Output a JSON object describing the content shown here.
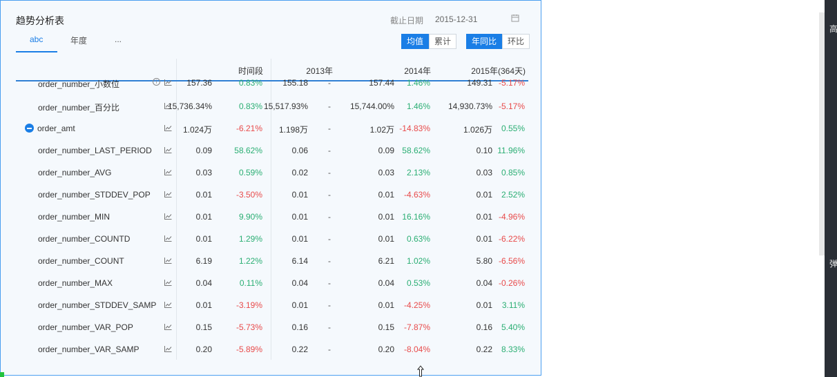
{
  "widget": {
    "title": "趋势分析表",
    "date_label": "截止日期",
    "date_value": "2015-12-31",
    "calendar_icon": "calendar-icon"
  },
  "tabs": [
    {
      "label": "abc",
      "active": true
    },
    {
      "label": "年度",
      "active": false
    },
    {
      "label": "...",
      "active": false
    }
  ],
  "toggle_groups": {
    "aggregate": [
      {
        "label": "均值",
        "active": true
      },
      {
        "label": "累计",
        "active": false
      }
    ],
    "compare": [
      {
        "label": "年同比",
        "active": true
      },
      {
        "label": "环比",
        "active": false
      }
    ]
  },
  "columns": [
    "时间段",
    "2013年",
    "2014年",
    "2015年(364天)"
  ],
  "rows": [
    {
      "name": "order_number_小数位",
      "icon": "info",
      "v2013": "157.36",
      "p2013": "0.83%",
      "d2013": "up",
      "v2014": "155.18",
      "p2014": "-",
      "d2014": "none",
      "v2015a": "157.44",
      "p2015a": "1.46%",
      "d2015a": "up",
      "v2015": "149.31",
      "p2015": "-5.17%",
      "d2015": "down"
    },
    {
      "name": "order_number_百分比",
      "icon": "",
      "v2013": "15,736.34%",
      "p2013": "0.83%",
      "d2013": "up",
      "v2014": "15,517.93%",
      "p2014": "-",
      "d2014": "none",
      "v2015a": "15,744.00%",
      "p2015a": "1.46%",
      "d2015a": "up",
      "v2015": "14,930.73%",
      "p2015": "-5.17%",
      "d2015": "down"
    },
    {
      "name": "order_amt",
      "icon": "collapse",
      "v2013": "1.024万",
      "p2013": "-6.21%",
      "d2013": "down",
      "v2014": "1.198万",
      "p2014": "-",
      "d2014": "none",
      "v2015a": "1.02万",
      "p2015a": "-14.83%",
      "d2015a": "down",
      "v2015": "1.026万",
      "p2015": "0.55%",
      "d2015": "up"
    },
    {
      "name": "order_number_LAST_PERIOD",
      "icon": "",
      "v2013": "0.09",
      "p2013": "58.62%",
      "d2013": "up",
      "v2014": "0.06",
      "p2014": "-",
      "d2014": "none",
      "v2015a": "0.09",
      "p2015a": "58.62%",
      "d2015a": "up",
      "v2015": "0.10",
      "p2015": "11.96%",
      "d2015": "up"
    },
    {
      "name": "order_number_AVG",
      "icon": "",
      "v2013": "0.03",
      "p2013": "0.59%",
      "d2013": "up",
      "v2014": "0.02",
      "p2014": "-",
      "d2014": "none",
      "v2015a": "0.03",
      "p2015a": "2.13%",
      "d2015a": "up",
      "v2015": "0.03",
      "p2015": "0.85%",
      "d2015": "up"
    },
    {
      "name": "order_number_STDDEV_POP",
      "icon": "",
      "v2013": "0.01",
      "p2013": "-3.50%",
      "d2013": "down",
      "v2014": "0.01",
      "p2014": "-",
      "d2014": "none",
      "v2015a": "0.01",
      "p2015a": "-4.63%",
      "d2015a": "down",
      "v2015": "0.01",
      "p2015": "2.52%",
      "d2015": "up"
    },
    {
      "name": "order_number_MIN",
      "icon": "",
      "v2013": "0.01",
      "p2013": "9.90%",
      "d2013": "up",
      "v2014": "0.01",
      "p2014": "-",
      "d2014": "none",
      "v2015a": "0.01",
      "p2015a": "16.16%",
      "d2015a": "up",
      "v2015": "0.01",
      "p2015": "-4.96%",
      "d2015": "down"
    },
    {
      "name": "order_number_COUNTD",
      "icon": "",
      "v2013": "0.01",
      "p2013": "1.29%",
      "d2013": "up",
      "v2014": "0.01",
      "p2014": "-",
      "d2014": "none",
      "v2015a": "0.01",
      "p2015a": "0.63%",
      "d2015a": "up",
      "v2015": "0.01",
      "p2015": "-6.22%",
      "d2015": "down"
    },
    {
      "name": "order_number_COUNT",
      "icon": "",
      "v2013": "6.19",
      "p2013": "1.22%",
      "d2013": "up",
      "v2014": "6.14",
      "p2014": "-",
      "d2014": "none",
      "v2015a": "6.21",
      "p2015a": "1.02%",
      "d2015a": "up",
      "v2015": "5.80",
      "p2015": "-6.56%",
      "d2015": "down"
    },
    {
      "name": "order_number_MAX",
      "icon": "",
      "v2013": "0.04",
      "p2013": "0.11%",
      "d2013": "up",
      "v2014": "0.04",
      "p2014": "-",
      "d2014": "none",
      "v2015a": "0.04",
      "p2015a": "0.53%",
      "d2015a": "up",
      "v2015": "0.04",
      "p2015": "-0.26%",
      "d2015": "down"
    },
    {
      "name": "order_number_STDDEV_SAMP",
      "icon": "",
      "v2013": "0.01",
      "p2013": "-3.19%",
      "d2013": "down",
      "v2014": "0.01",
      "p2014": "-",
      "d2014": "none",
      "v2015a": "0.01",
      "p2015a": "-4.25%",
      "d2015a": "down",
      "v2015": "0.01",
      "p2015": "3.11%",
      "d2015": "up"
    },
    {
      "name": "order_number_VAR_POP",
      "icon": "",
      "v2013": "0.15",
      "p2013": "-5.73%",
      "d2013": "down",
      "v2014": "0.16",
      "p2014": "-",
      "d2014": "none",
      "v2015a": "0.15",
      "p2015a": "-7.87%",
      "d2015a": "down",
      "v2015": "0.16",
      "p2015": "5.40%",
      "d2015": "up"
    },
    {
      "name": "order_number_VAR_SAMP",
      "icon": "",
      "v2013": "0.20",
      "p2013": "-5.89%",
      "d2013": "down",
      "v2014": "0.22",
      "p2014": "-",
      "d2014": "none",
      "v2015a": "0.20",
      "p2015a": "-8.04%",
      "d2015a": "down",
      "v2015": "0.22",
      "p2015": "8.33%",
      "d2015": "up"
    }
  ],
  "sidebar": {
    "chars": [
      "高",
      "弹"
    ]
  },
  "colors": {
    "accent": "#1a7ee6",
    "up": "#2aae73",
    "down": "#e84a4a"
  }
}
